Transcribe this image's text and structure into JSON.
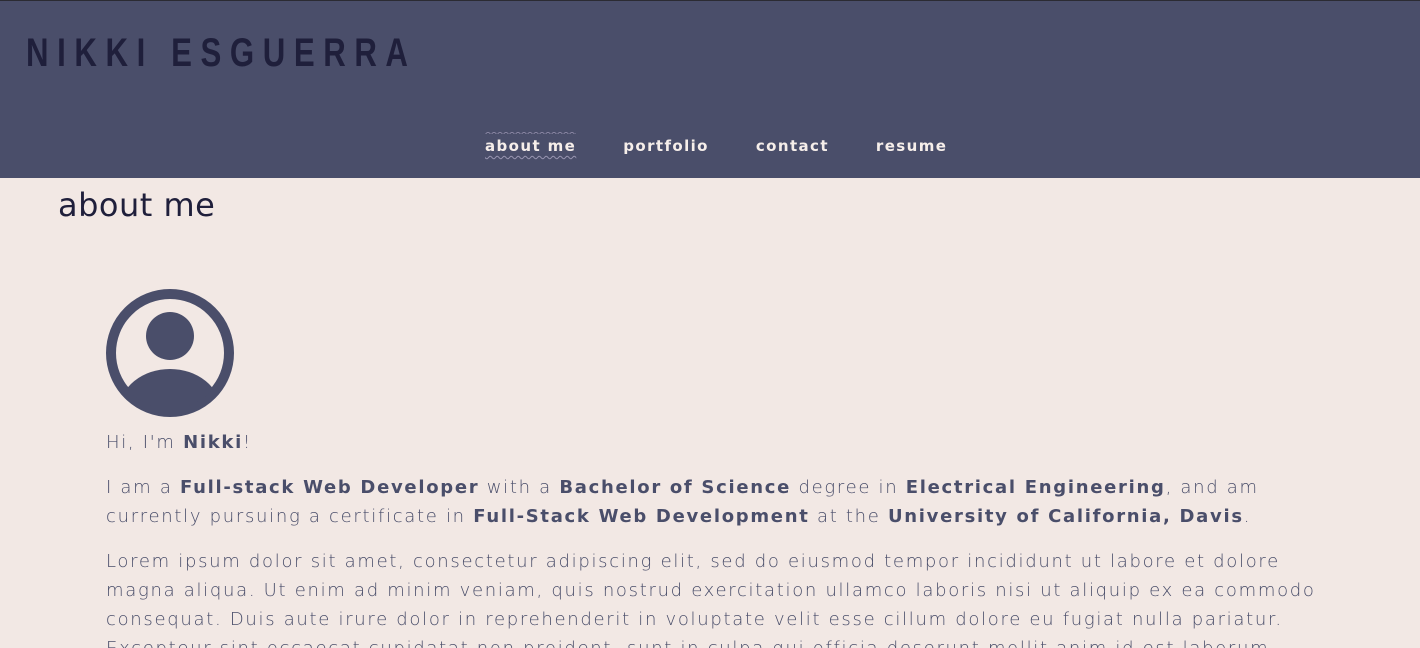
{
  "header": {
    "brand": "NIKKI ESGUERRA",
    "nav": [
      {
        "label": "about me",
        "active": true
      },
      {
        "label": "portfolio",
        "active": false
      },
      {
        "label": "contact",
        "active": false
      },
      {
        "label": "resume",
        "active": false
      }
    ]
  },
  "main": {
    "title": "about me",
    "avatar_icon": "user-circle-icon",
    "greeting": {
      "prefix": "Hi, I'm ",
      "name": "Nikki",
      "suffix": "!"
    },
    "intro": {
      "p1": "I am a ",
      "b1": "Full-stack Web Developer",
      "p2": " with a ",
      "b2": "Bachelor of Science",
      "p3": " degree in ",
      "b3": "Electrical Engineering",
      "p4": ", and am currently pursuing a certificate in ",
      "b4": "Full-Stack Web Development",
      "p5": " at the ",
      "b5": "University of California, Davis",
      "p6": "."
    },
    "lorem": "Lorem ipsum dolor sit amet, consectetur adipiscing elit, sed do eiusmod tempor incididunt ut labore et dolore magna aliqua. Ut enim ad minim veniam, quis nostrud exercitation ullamco laboris nisi ut aliquip ex ea commodo consequat. Duis aute irure dolor in reprehenderit in voluptate velit esse cillum dolore eu fugiat nulla pariatur. Excepteur sint occaecat cupidatat non proident, sunt in culpa qui officia deserunt mollit anim id est laborum."
  },
  "colors": {
    "header_bg": "#4a4e6a",
    "page_bg": "#f2e8e4",
    "brand_text": "#1f1f3b",
    "nav_text": "#f6eeea",
    "body_text": "#4a4e6a"
  }
}
